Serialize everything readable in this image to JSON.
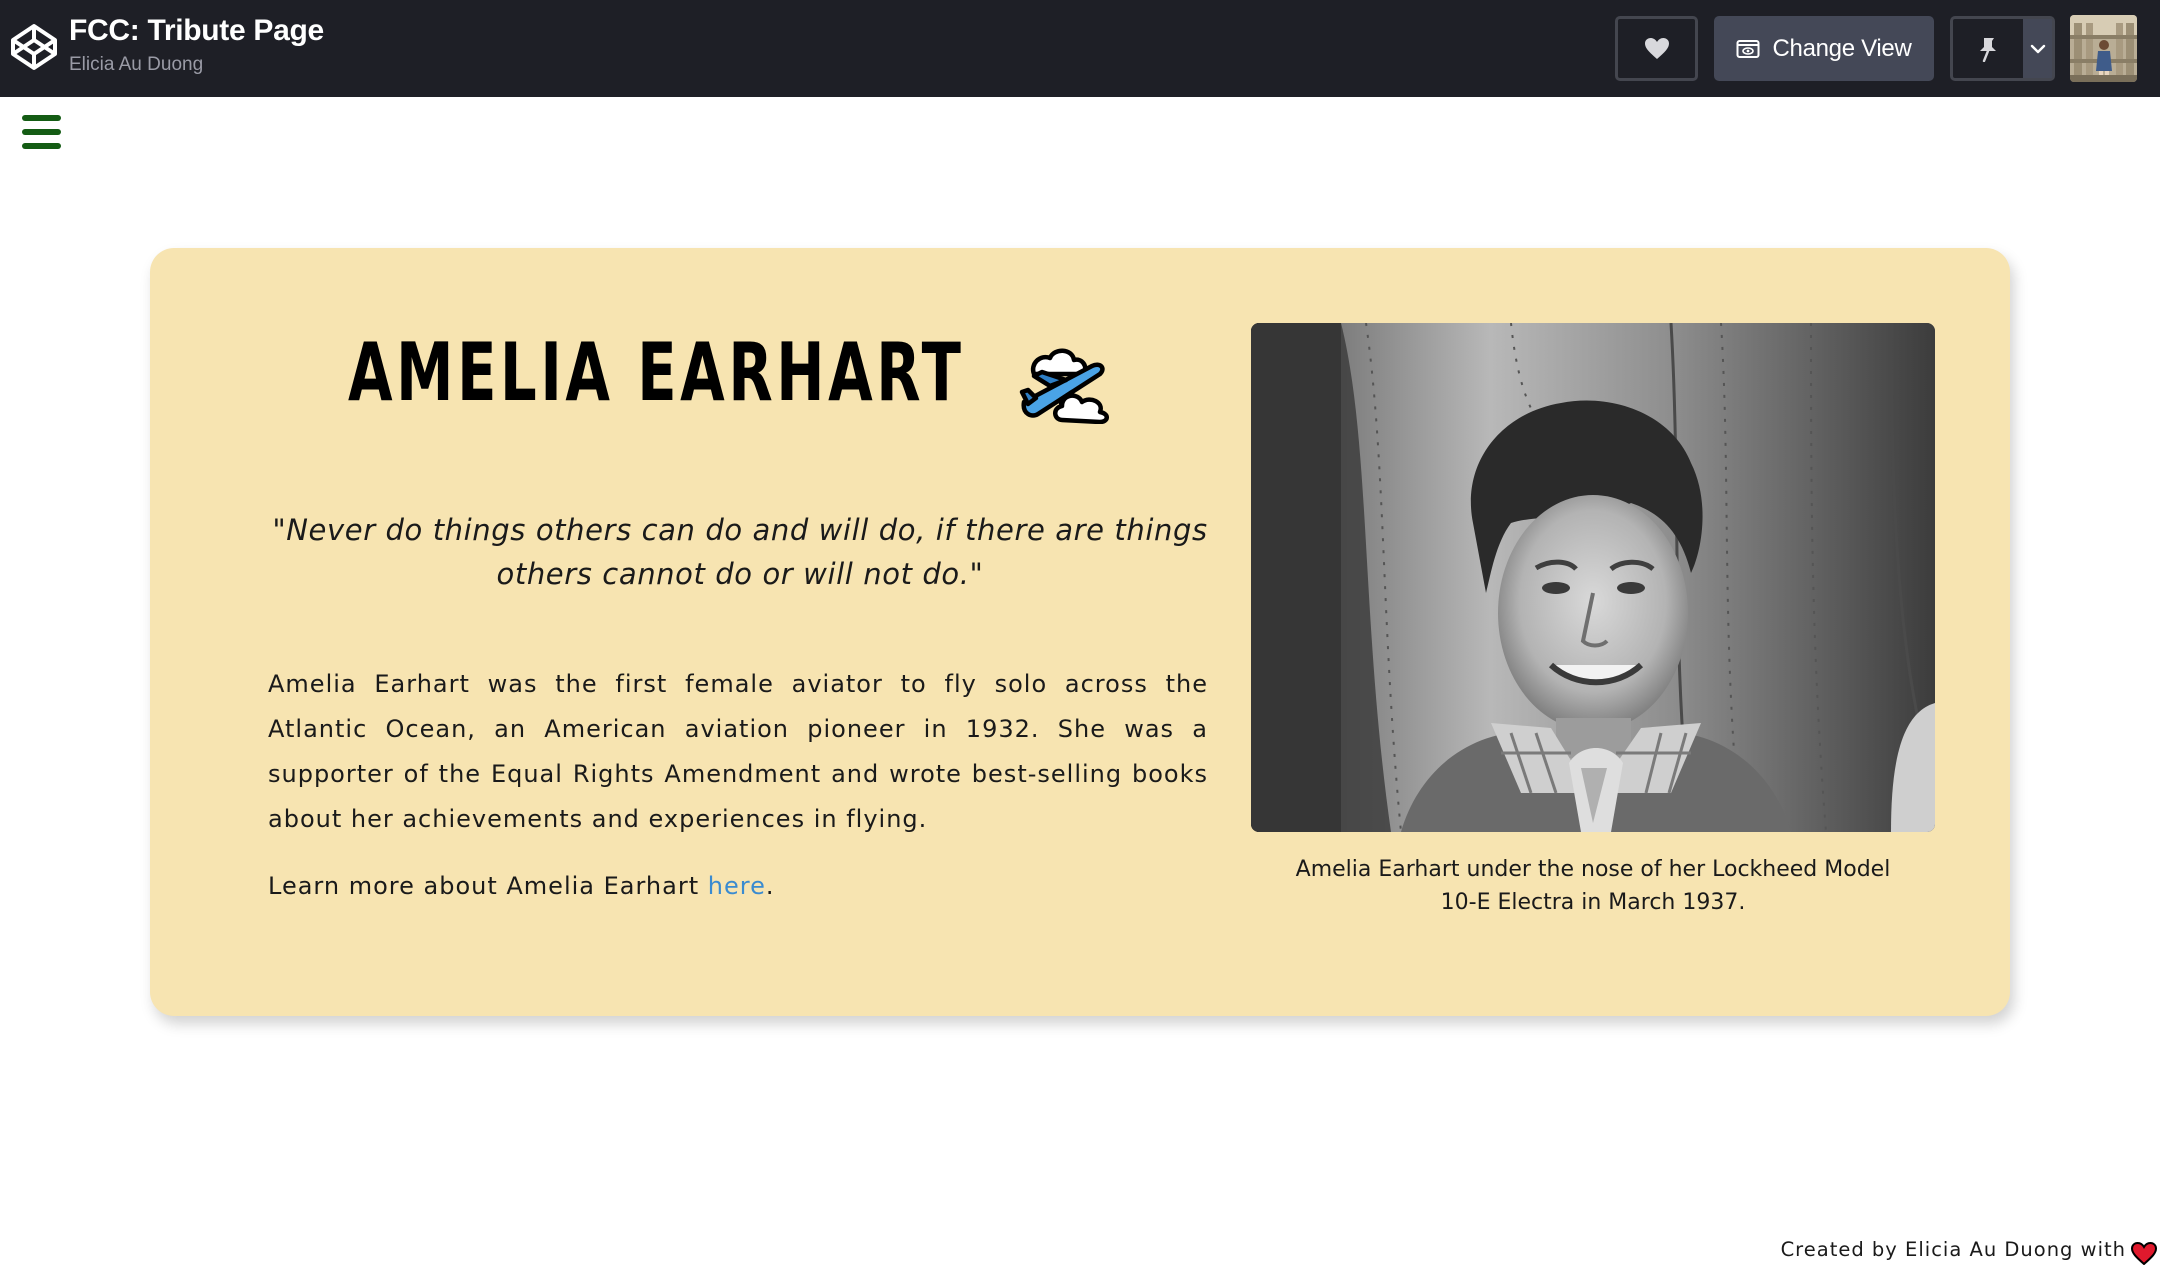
{
  "header": {
    "title": "FCC: Tribute Page",
    "author": "Elicia Au Duong",
    "logo_icon": "codepen-logo-icon",
    "like_icon": "heart-icon",
    "change_view_label": "Change View",
    "change_view_icon": "eye-window-icon",
    "pin_icon": "pin-icon",
    "pin_menu_icon": "chevron-down-icon",
    "avatar": "user-avatar"
  },
  "menu": {
    "icon": "hamburger-menu-icon"
  },
  "tribute": {
    "heading": "AMELIA EARHART",
    "heading_emoji": "airplane-cloud-icon",
    "quote": "\"Never do things others can do and will do, if there are things others cannot do or will not do.\"",
    "bio": "Amelia Earhart was the first female aviator to fly solo across the Atlantic Ocean, an American aviation pioneer in 1932. She was a supporter of the Equal Rights Amendment and wrote best-selling books about her achievements and experiences in flying.",
    "learn_more_prefix": "Learn more about Amelia Earhart ",
    "learn_more_link": "here",
    "learn_more_suffix": ".",
    "image_alt": "Amelia Earhart portrait photo",
    "caption": "Amelia Earhart under the nose of her Lockheed Model 10-E Electra in March 1937."
  },
  "footer": {
    "text": "Created by Elicia Au Duong with",
    "heart_icon": "heart-icon"
  },
  "colors": {
    "topbar": "#1e1f26",
    "card": "#f7e4b1",
    "link": "#3a8bd0",
    "menu": "#145c14",
    "heart": "#e0192d"
  }
}
